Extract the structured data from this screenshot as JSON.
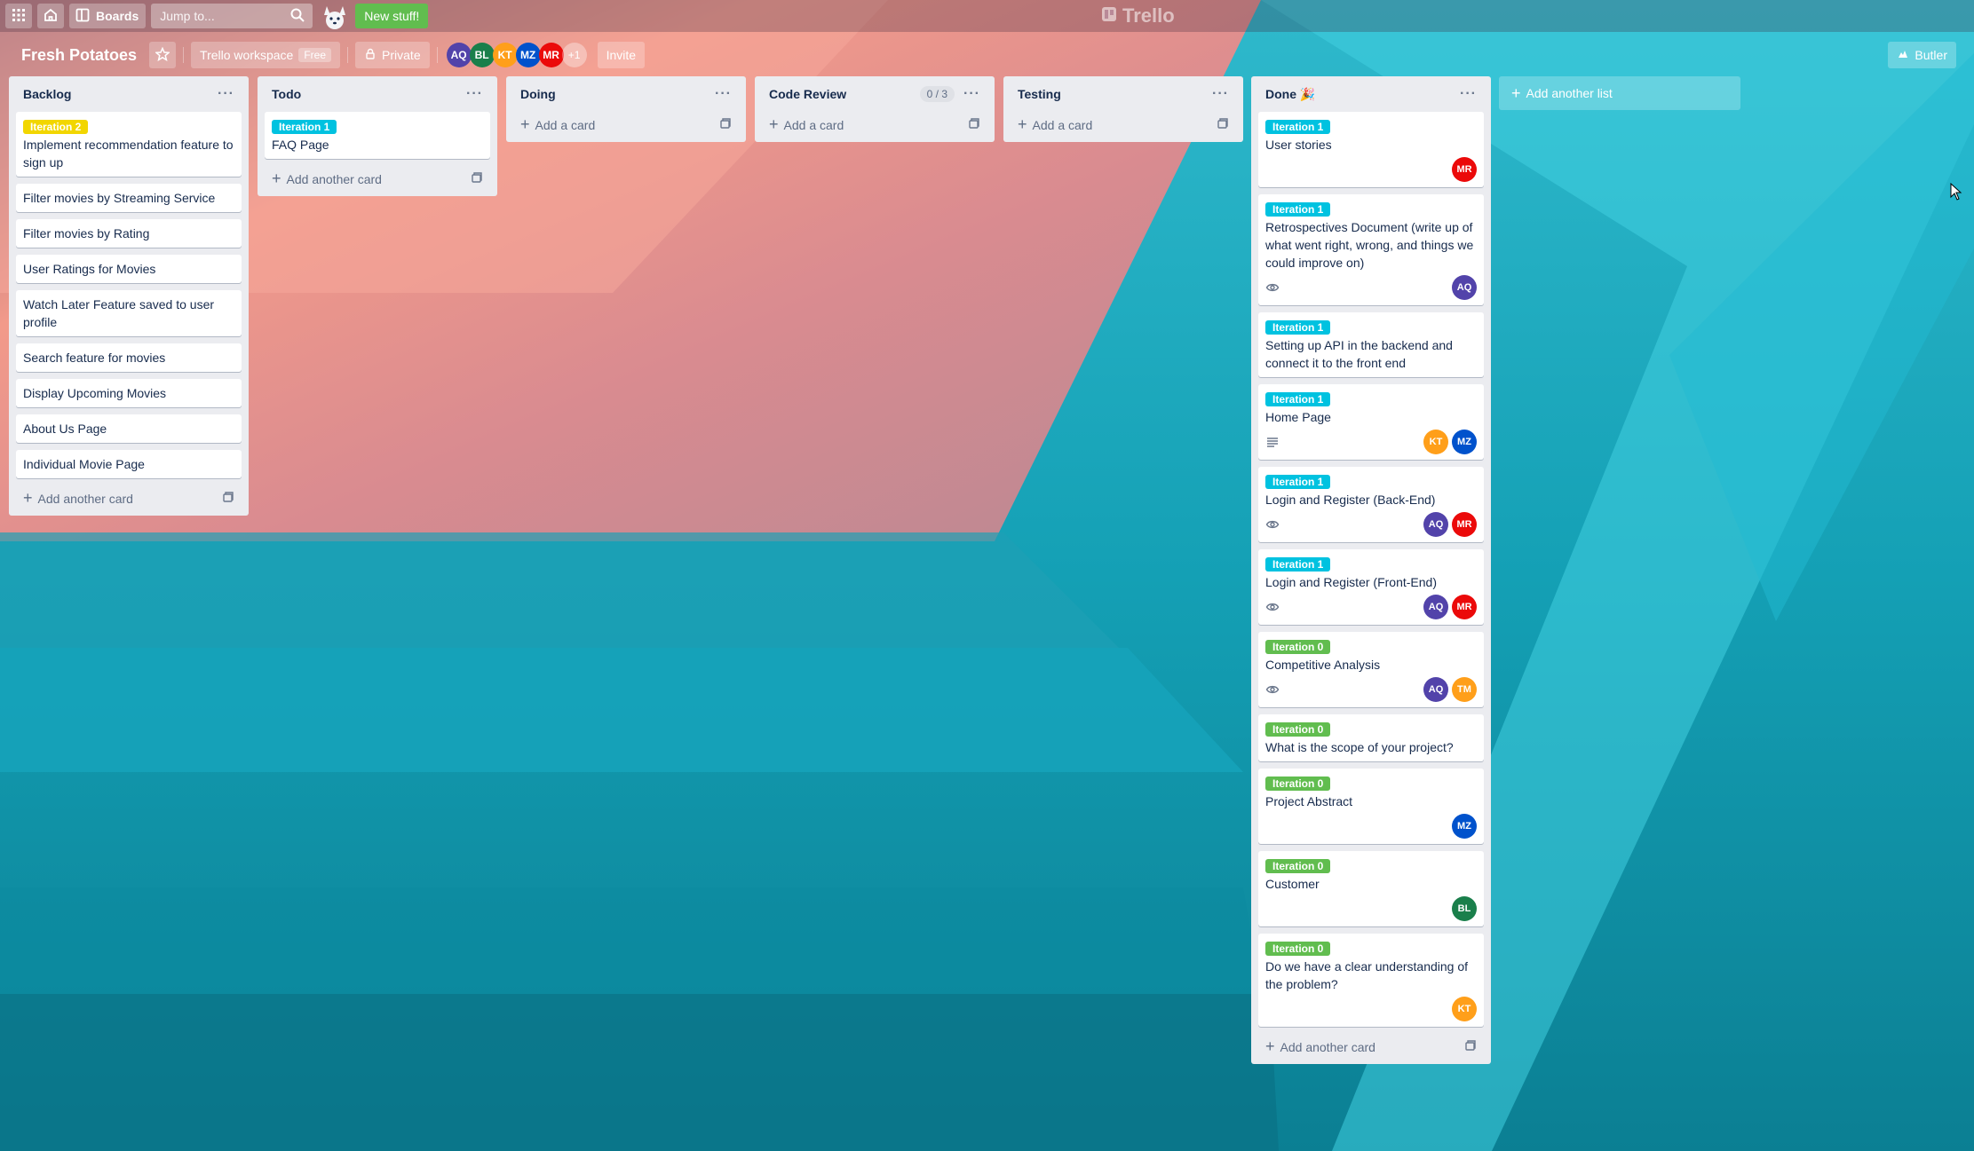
{
  "colors": {
    "label_yellow": "#f2d600",
    "label_sky": "#00c2e0",
    "label_green": "#61bd4f",
    "av_AQ": "#5243aa",
    "av_BL": "#1a7f4b",
    "av_KT": "#ff9f1a",
    "av_MZ": "#0052cc",
    "av_MR": "#eb0a0a",
    "av_TM": "#ff9f1a"
  },
  "topbar": {
    "apps_icon": "grid-icon",
    "home_icon": "home-icon",
    "boards_label": "Boards",
    "search_placeholder": "Jump to...",
    "new_stuff_label": "New stuff!",
    "logo_text": "Trello"
  },
  "board": {
    "title": "Fresh Potatoes",
    "workspace_label": "Trello workspace",
    "workspace_badge": "Free",
    "visibility_label": "Private",
    "members": [
      "AQ",
      "BL",
      "KT",
      "MZ",
      "MR"
    ],
    "members_more": "+1",
    "invite_label": "Invite",
    "butler_label": "Butler"
  },
  "lists": {
    "backlog": {
      "title": "Backlog",
      "cards": [
        {
          "label": "Iteration 2",
          "title": "Implement recommendation feature to sign up"
        },
        {
          "title": "Filter movies by Streaming Service"
        },
        {
          "title": "Filter movies by Rating"
        },
        {
          "title": "User Ratings for Movies"
        },
        {
          "title": "Watch Later Feature saved to user profile"
        },
        {
          "title": "Search feature for movies"
        },
        {
          "title": "Display Upcoming Movies"
        },
        {
          "title": "About Us Page"
        },
        {
          "title": "Individual Movie Page"
        }
      ],
      "add_label": "Add another card"
    },
    "todo": {
      "title": "Todo",
      "cards": [
        {
          "label": "Iteration 1",
          "title": "FAQ Page"
        }
      ],
      "add_label": "Add another card"
    },
    "doing": {
      "title": "Doing",
      "add_label": "Add a card"
    },
    "code_review": {
      "title": "Code Review",
      "wip": "0 / 3",
      "add_label": "Add a card"
    },
    "testing": {
      "title": "Testing",
      "add_label": "Add a card"
    },
    "done": {
      "title": "Done 🎉",
      "cards": [
        {
          "label": "Iteration 1",
          "title": "User stories",
          "members": [
            "MR"
          ]
        },
        {
          "label": "Iteration 1",
          "title": "Retrospectives Document (write up of what went right, wrong, and things we could improve on)",
          "badge": "eye-icon",
          "members": [
            "AQ"
          ]
        },
        {
          "label": "Iteration 1",
          "title": "Setting up API in the backend and connect it to the front end"
        },
        {
          "label": "Iteration 1",
          "title": "Home Page",
          "badge": "description-icon",
          "members": [
            "KT",
            "MZ"
          ]
        },
        {
          "label": "Iteration 1",
          "title": "Login and Register (Back-End)",
          "badge": "eye-icon",
          "members": [
            "AQ",
            "MR"
          ]
        },
        {
          "label": "Iteration 1",
          "title": "Login and Register (Front-End)",
          "badge": "eye-icon",
          "members": [
            "AQ",
            "MR"
          ]
        },
        {
          "label": "Iteration 0",
          "title": "Competitive Analysis",
          "badge": "eye-icon",
          "members": [
            "AQ",
            "TM"
          ]
        },
        {
          "label": "Iteration 0",
          "title": "What is the scope of your project?"
        },
        {
          "label": "Iteration 0",
          "title": "Project Abstract",
          "members": [
            "MZ"
          ]
        },
        {
          "label": "Iteration 0",
          "title": "Customer",
          "members": [
            "BL"
          ]
        },
        {
          "label": "Iteration 0",
          "title": "Do we have a clear understanding of the problem?",
          "members": [
            "KT"
          ]
        }
      ],
      "add_label": "Add another card"
    },
    "add_list_label": "Add another list"
  }
}
